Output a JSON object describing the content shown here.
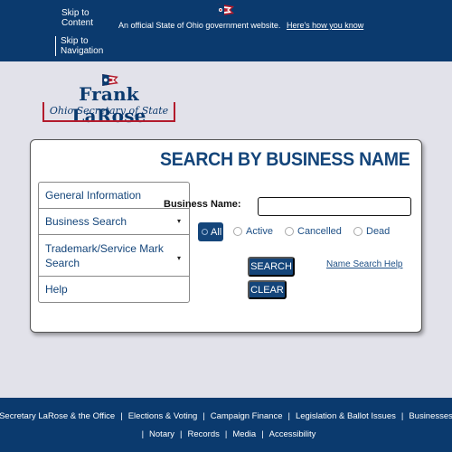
{
  "topbar": {
    "skip_content": "Skip to Content",
    "skip_nav": "Skip to Navigation",
    "official_text": "An official State of Ohio government website.",
    "official_link": "Here's how you know"
  },
  "logo": {
    "name": "Frank LaRose",
    "subtitle": "Ohio Secretary of State"
  },
  "page": {
    "title": "SEARCH BY BUSINESS NAME"
  },
  "sidenav": {
    "items": [
      {
        "label": "General Information"
      },
      {
        "label": "Business Search"
      },
      {
        "label": "Trademark/Service Mark Search"
      },
      {
        "label": "Help"
      }
    ],
    "chevron": "▾"
  },
  "form": {
    "business_name_label": "Business Name:",
    "business_name_value": "",
    "status_options": [
      "All",
      "Active",
      "Cancelled",
      "Dead"
    ],
    "selected_status": "All",
    "search_label": "SEARCH",
    "clear_label": "CLEAR",
    "help_link": "Name Search Help"
  },
  "footer": {
    "row1": [
      "Secretary LaRose & the Office",
      "Elections & Voting",
      "Campaign Finance",
      "Legislation & Ballot Issues",
      "Businesses"
    ],
    "row2": [
      "Notary",
      "Records",
      "Media",
      "Accessibility"
    ]
  },
  "colors": {
    "navy": "#0b3a6e",
    "accent_blue": "#14457a",
    "red": "#b31b2c",
    "background": "#e2e2ea"
  }
}
